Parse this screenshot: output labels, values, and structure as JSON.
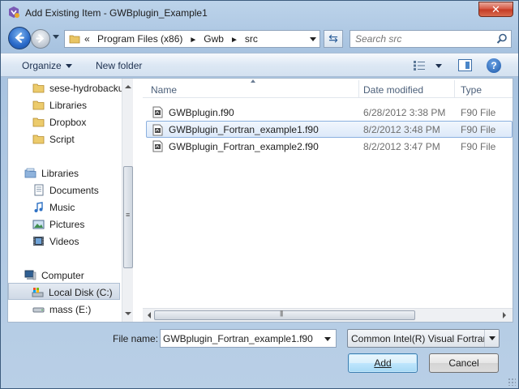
{
  "window": {
    "title": "Add Existing Item - GWBplugin_Example1",
    "close_label": "✕"
  },
  "address": {
    "overflow": "«",
    "crumbs": [
      "Program Files (x86)",
      "Gwb",
      "src"
    ]
  },
  "search": {
    "placeholder": "Search src"
  },
  "toolbar": {
    "organize_label": "Organize",
    "new_folder_label": "New folder",
    "help_label": "?"
  },
  "nav": {
    "items": [
      {
        "label": "sese-hydrobacku",
        "icon": "folder-icon"
      },
      {
        "label": "Libraries",
        "icon": "folder-icon"
      },
      {
        "label": "Dropbox",
        "icon": "folder-icon"
      },
      {
        "label": "Script",
        "icon": "folder-icon"
      },
      {
        "label": "Libraries",
        "icon": "libraries-icon"
      },
      {
        "label": "Documents",
        "icon": "documents-icon"
      },
      {
        "label": "Music",
        "icon": "music-icon"
      },
      {
        "label": "Pictures",
        "icon": "pictures-icon"
      },
      {
        "label": "Videos",
        "icon": "videos-icon"
      },
      {
        "label": "Computer",
        "icon": "computer-icon"
      },
      {
        "label": "Local Disk (C:)",
        "icon": "local-disk-icon"
      },
      {
        "label": "mass (E:)",
        "icon": "drive-icon"
      }
    ]
  },
  "files": {
    "columns": {
      "name": "Name",
      "date": "Date modified",
      "type": "Type"
    },
    "rows": [
      {
        "name": "GWBplugin.f90",
        "date": "6/28/2012 3:38 PM",
        "type": "F90 File"
      },
      {
        "name": "GWBplugin_Fortran_example1.f90",
        "date": "8/2/2012 3:48 PM",
        "type": "F90 File"
      },
      {
        "name": "GWBplugin_Fortran_example2.f90",
        "date": "8/2/2012 3:47 PM",
        "type": "F90 File"
      }
    ],
    "selected_index": 1
  },
  "footer": {
    "file_name_label": "File name:",
    "file_name_value": "GWBplugin_Fortran_example1.f90",
    "filter_value": "Common Intel(R) Visual Fortran",
    "add_label": "Add",
    "cancel_label": "Cancel"
  },
  "colors": {
    "selection": "#dce9f9",
    "accent": "#3c7fb1",
    "close": "#c43a24"
  }
}
